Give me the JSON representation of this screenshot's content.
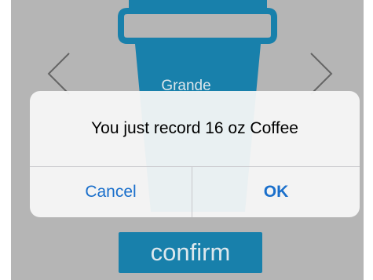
{
  "background": {
    "cup_color": "#1a87b5",
    "screen_color": "#bfbfbf",
    "size_label": "Grande"
  },
  "nav": {
    "prev_icon": "chevron-left-icon",
    "next_icon": "chevron-right-icon"
  },
  "confirm": {
    "label": "confirm"
  },
  "alert": {
    "message": "You just record 16 oz Coffee",
    "cancel_label": "Cancel",
    "ok_label": "OK",
    "button_color": "#1a6fcb"
  }
}
